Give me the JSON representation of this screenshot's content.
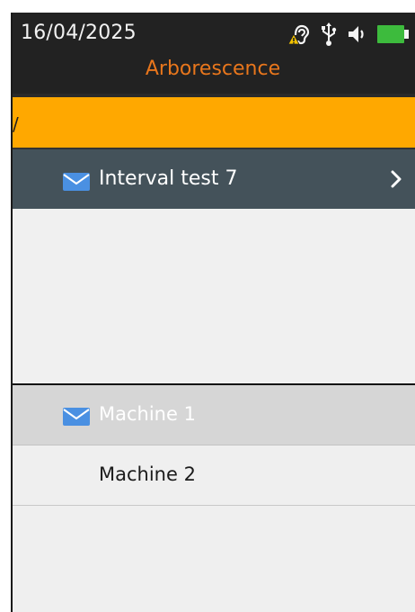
{
  "header": {
    "date": "16/04/2025",
    "title": "Arborescence",
    "status_icons": [
      "hearing-warning-icon",
      "usb-icon",
      "speaker-icon",
      "battery-icon"
    ]
  },
  "path": {
    "value": "/"
  },
  "folder": {
    "label": "Interval test 7",
    "icon": "envelope-icon"
  },
  "list": {
    "items": [
      {
        "label": "Machine 1",
        "icon": "envelope-icon",
        "selected": true
      },
      {
        "label": "Machine 2",
        "icon": null,
        "selected": false
      }
    ]
  },
  "colors": {
    "header_bg": "#222222",
    "title": "#e8761c",
    "path_bar": "#ffa800",
    "folder_row": "#44525a",
    "selected_row": "#d6d6d6",
    "envelope": "#4a90e2",
    "battery": "#3dbb3d",
    "warning": "#f2c200"
  }
}
